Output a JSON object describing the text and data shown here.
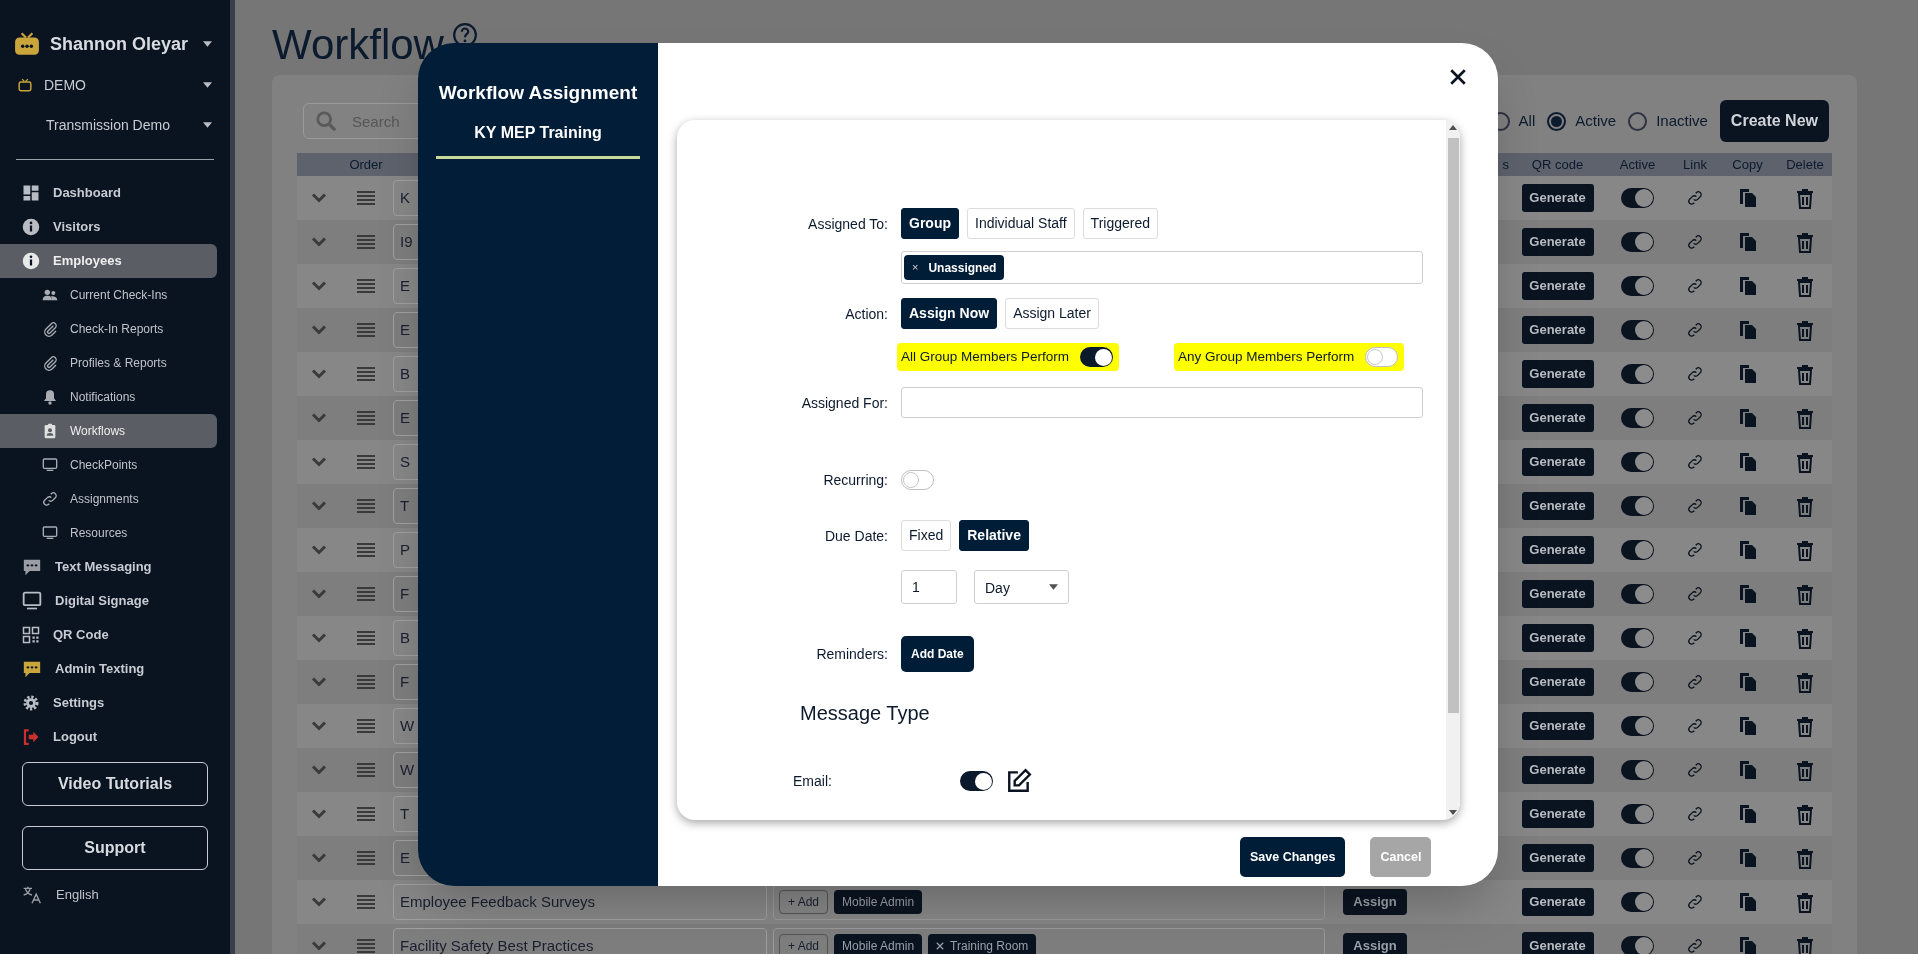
{
  "sidebar": {
    "user_name": "Shannon Oleyar",
    "account": "DEMO",
    "location": "Transmission Demo",
    "nav": [
      {
        "label": "Dashboard",
        "selected": false
      },
      {
        "label": "Visitors",
        "selected": false
      },
      {
        "label": "Employees",
        "selected": true,
        "children": [
          {
            "label": "Current Check-Ins",
            "selected": false
          },
          {
            "label": "Check-In Reports",
            "selected": false
          },
          {
            "label": "Profiles & Reports",
            "selected": false
          },
          {
            "label": "Notifications",
            "selected": false
          },
          {
            "label": "Workflows",
            "selected": true
          },
          {
            "label": "CheckPoints",
            "selected": false
          },
          {
            "label": "Assignments",
            "selected": false
          },
          {
            "label": "Resources",
            "selected": false
          }
        ]
      },
      {
        "label": "Text Messaging",
        "selected": false
      },
      {
        "label": "Digital Signage",
        "selected": false
      },
      {
        "label": "QR Code",
        "selected": false
      },
      {
        "label": "Admin Texting",
        "selected": false
      },
      {
        "label": "Settings",
        "selected": false
      },
      {
        "label": "Logout",
        "selected": false
      }
    ],
    "buttons": [
      "Video Tutorials",
      "Support"
    ],
    "language": "English"
  },
  "page": {
    "title": "Workflow",
    "search": {
      "placeholder": "Search"
    },
    "filters": [
      {
        "label": "All",
        "selected": false
      },
      {
        "label": "Active",
        "selected": true
      },
      {
        "label": "Inactive",
        "selected": false
      }
    ],
    "create_button": "Create New",
    "table": {
      "columns": [
        "Order",
        "s",
        "QR code",
        "Active",
        "Link",
        "Copy",
        "Delete"
      ],
      "rows": [
        {
          "name": "K",
          "generate": "Generate",
          "active": true
        },
        {
          "name": "I9",
          "generate": "Generate",
          "active": true
        },
        {
          "name": "E",
          "generate": "Generate",
          "active": true
        },
        {
          "name": "E",
          "generate": "Generate",
          "active": true
        },
        {
          "name": "B",
          "generate": "Generate",
          "active": true
        },
        {
          "name": "E",
          "generate": "Generate",
          "active": true
        },
        {
          "name": "S",
          "generate": "Generate",
          "active": true
        },
        {
          "name": "T",
          "generate": "Generate",
          "active": true
        },
        {
          "name": "P",
          "generate": "Generate",
          "active": true
        },
        {
          "name": "F",
          "generate": "Generate",
          "active": true
        },
        {
          "name": "B",
          "generate": "Generate",
          "active": true
        },
        {
          "name": "F",
          "generate": "Generate",
          "active": true
        },
        {
          "name": "W",
          "generate": "Generate",
          "active": true
        },
        {
          "name": "W",
          "generate": "Generate",
          "active": true
        },
        {
          "name": "T",
          "generate": "Generate",
          "active": true
        },
        {
          "name": "E",
          "generate": "Generate",
          "active": true
        },
        {
          "name": "Employee Feedback Surveys",
          "add": "+ Add",
          "tags": [
            {
              "label": "Mobile Admin",
              "removable": false
            }
          ],
          "assign": "Assign",
          "generate": "Generate",
          "active": true
        },
        {
          "name": "Facility Safety Best Practices",
          "add": "+ Add",
          "tags": [
            {
              "label": "Mobile Admin",
              "removable": false
            },
            {
              "label": "Training Room",
              "removable": true
            }
          ],
          "assign": "Assign",
          "generate": "Generate",
          "active": true
        }
      ]
    }
  },
  "modal": {
    "title": "Workflow Assignment",
    "subtitle": "KY MEP Training",
    "assigned_to": {
      "label": "Assigned To:",
      "options": [
        {
          "label": "Group",
          "selected": true
        },
        {
          "label": "Individual Staff",
          "selected": false
        },
        {
          "label": "Triggered",
          "selected": false
        }
      ]
    },
    "groups": [
      {
        "label": "Unassigned",
        "remove": "×"
      }
    ],
    "action": {
      "label": "Action:",
      "options": [
        {
          "label": "Assign Now",
          "selected": true
        },
        {
          "label": "Assign Later",
          "selected": false
        }
      ]
    },
    "perform_toggles": [
      {
        "label": "All Group Members Perform",
        "on": true,
        "highlighted": true
      },
      {
        "label": "Any Group Members Perform",
        "on": false,
        "highlighted": true
      }
    ],
    "assigned_for": {
      "label": "Assigned For:"
    },
    "recurring": {
      "label": "Recurring:",
      "on": false
    },
    "due_date": {
      "label": "Due Date:",
      "options": [
        {
          "label": "Fixed",
          "selected": false
        },
        {
          "label": "Relative",
          "selected": true
        }
      ],
      "amount": "1",
      "unit": "Day"
    },
    "reminders": {
      "label": "Reminders:",
      "button": "Add Date"
    },
    "message_type": {
      "heading": "Message Type",
      "channels": [
        {
          "label": "Email:",
          "on": true
        }
      ]
    },
    "footer_buttons": [
      {
        "label": "Save Changes",
        "kind": "primary"
      },
      {
        "label": "Cancel",
        "kind": "secondary"
      }
    ]
  }
}
